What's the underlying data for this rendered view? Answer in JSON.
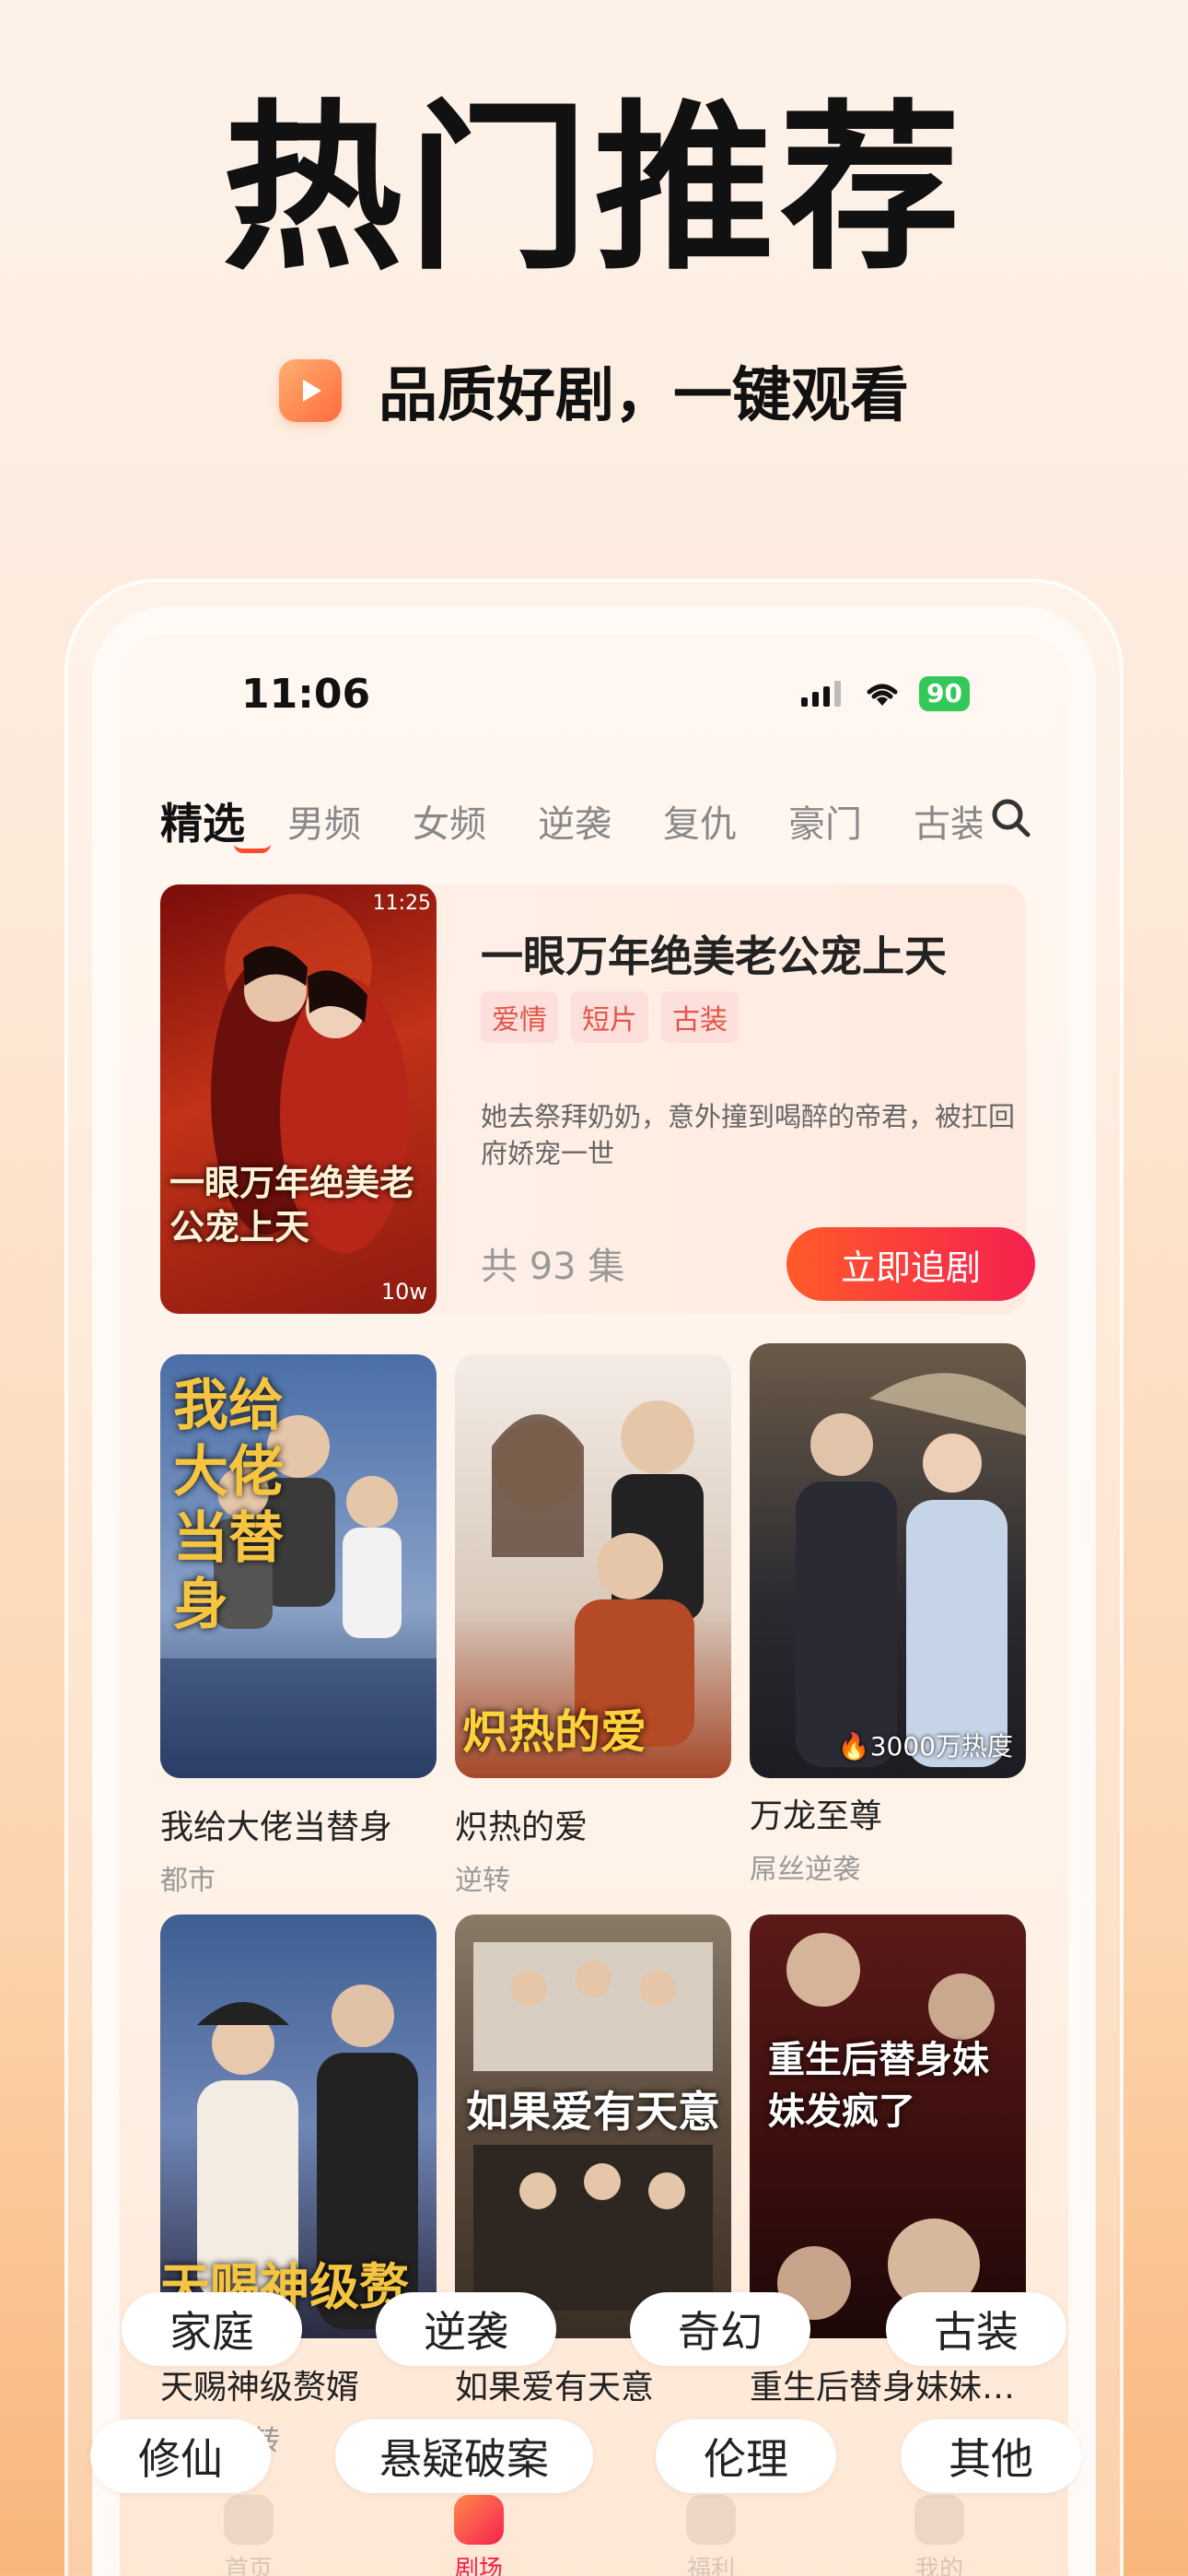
{
  "hero": {
    "title": "热门推荐",
    "subtitle": "品质好剧，一键观看"
  },
  "status_bar": {
    "time": "11:06",
    "battery": "90"
  },
  "tabs": [
    "精选",
    "男频",
    "女频",
    "逆袭",
    "复仇",
    "豪门",
    "古装"
  ],
  "active_tab": "精选",
  "featured": {
    "poster_time": "11:25",
    "poster_art_text": "一眼万年绝美老公宠上天",
    "poster_count": "10w",
    "title": "一眼万年绝美老公宠上天",
    "tags": [
      "爱情",
      "短片",
      "古装"
    ],
    "description": "她去祭拜奶奶，意外撞到喝醉的帝君，被扛回府娇宠一世",
    "episodes": "共 93 集",
    "follow_label": "立即追剧"
  },
  "grid": [
    {
      "title": "我给大佬当替身",
      "genre": "都市",
      "art": "我给大佬当替身",
      "heat": ""
    },
    {
      "title": "炽热的爱",
      "genre": "逆转",
      "art": "炽热的爱",
      "heat": ""
    },
    {
      "title": "万龙至尊",
      "genre": "屌丝逆袭",
      "art": "",
      "heat": "3000万热度"
    },
    {
      "title": "天赐神级赘婿",
      "genre": "逆袭/反转",
      "art": "天赐神级赘婿",
      "heat": ""
    },
    {
      "title": "如果爱有天意",
      "genre": "",
      "art": "如果爱有天意",
      "heat": ""
    },
    {
      "title": "重生后替身妹妹…",
      "genre": "",
      "art": "重生后替身妹妹发疯了",
      "heat": ""
    }
  ],
  "chips": [
    "家庭",
    "逆袭",
    "奇幻",
    "古装",
    "修仙",
    "悬疑破案",
    "伦理",
    "其他"
  ],
  "bottom_nav": [
    "首页",
    "剧场",
    "福利",
    "我的"
  ],
  "colors": {
    "accent": "#f5214f",
    "accent_orange": "#ff5a2a",
    "tag_bg": "#fde0dc",
    "tag_text": "#e25546"
  }
}
